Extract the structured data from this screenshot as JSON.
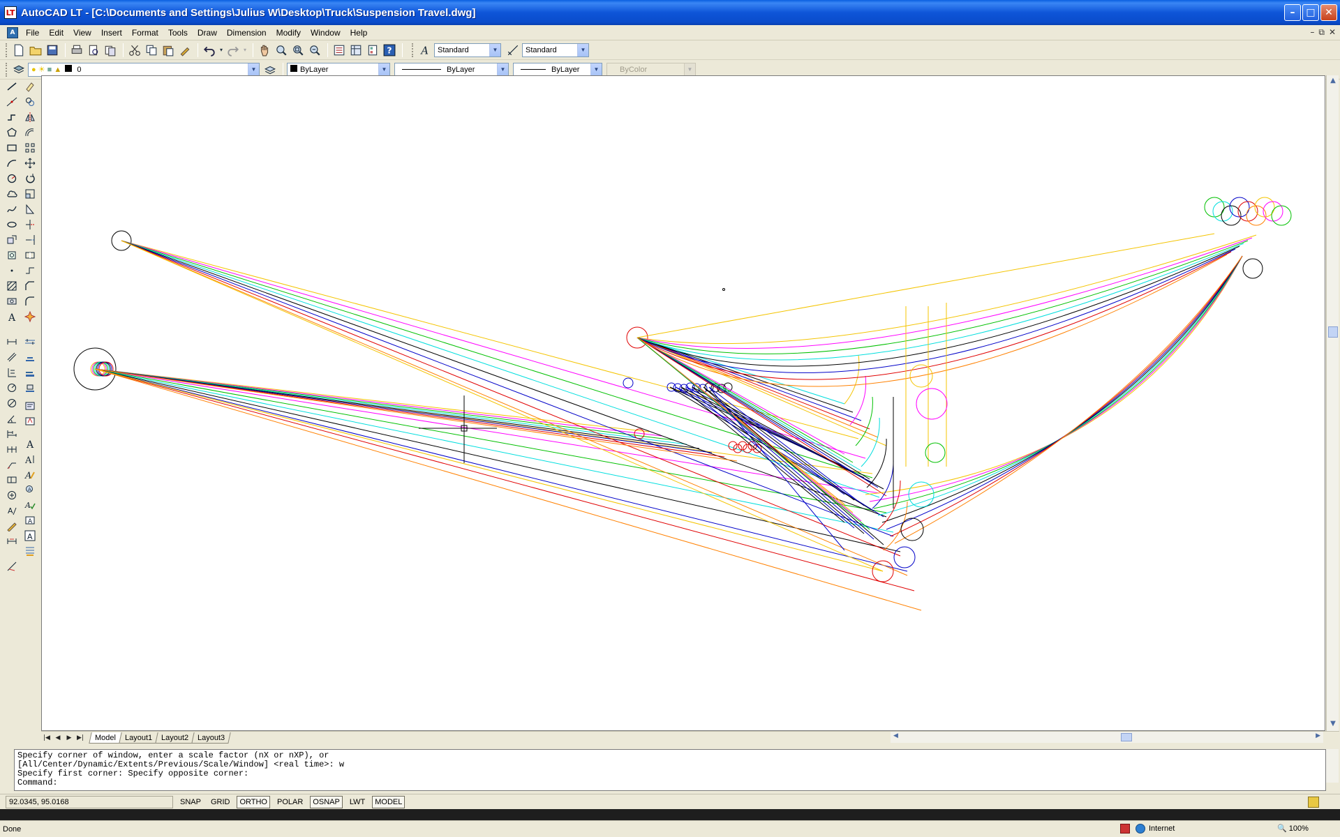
{
  "window": {
    "app_icon": "LT",
    "title": "AutoCAD LT - [C:\\Documents and Settings\\Julius W\\Desktop\\Truck\\Suspension Travel.dwg]"
  },
  "menu": [
    "File",
    "Edit",
    "View",
    "Insert",
    "Format",
    "Tools",
    "Draw",
    "Dimension",
    "Modify",
    "Window",
    "Help"
  ],
  "toolbar": {
    "text_style": "Standard",
    "dim_style": "Standard",
    "layer": "0",
    "color": "ByLayer",
    "linetype": "ByLayer",
    "lineweight": "ByLayer",
    "plot_style": "ByColor"
  },
  "layout_tabs": [
    "Model",
    "Layout1",
    "Layout2",
    "Layout3"
  ],
  "command_window": {
    "lines": [
      "Specify corner of window, enter a scale factor (nX or nXP), or",
      "[All/Center/Dynamic/Extents/Previous/Scale/Window] <real time>: w",
      "Specify first corner: Specify opposite corner:",
      "Command:"
    ]
  },
  "status": {
    "coords": "92.0345, 95.0168",
    "toggles": [
      {
        "label": "SNAP",
        "on": false
      },
      {
        "label": "GRID",
        "on": false
      },
      {
        "label": "ORTHO",
        "on": true
      },
      {
        "label": "POLAR",
        "on": false
      },
      {
        "label": "OSNAP",
        "on": true
      },
      {
        "label": "LWT",
        "on": false
      },
      {
        "label": "MODEL",
        "on": true
      }
    ]
  },
  "browser_status": {
    "text": "Done",
    "zone": "Internet",
    "zoom": "100%"
  },
  "colors": {
    "series": [
      "#f4c400",
      "#ff00ff",
      "#00c000",
      "#00dede",
      "#000000",
      "#0000c8",
      "#e00000",
      "#ff8000"
    ]
  }
}
